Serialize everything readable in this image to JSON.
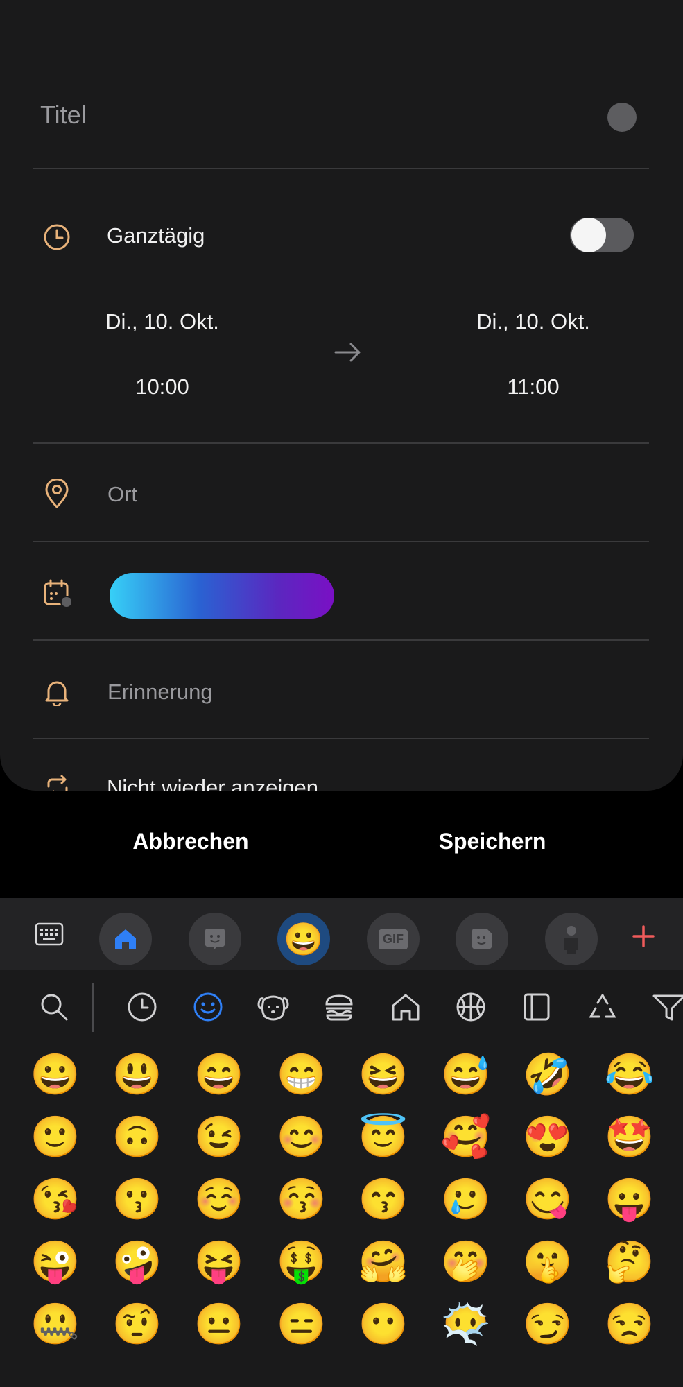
{
  "form": {
    "title_placeholder": "Titel",
    "all_day_label": "Ganztägig",
    "all_day_on": false,
    "start_date": "Di., 10. Okt.",
    "start_time": "10:00",
    "end_date": "Di., 10. Okt.",
    "end_time": "11:00",
    "location_placeholder": "Ort",
    "reminder_placeholder": "Erinnerung",
    "repeat_label": "Nicht wieder anzeigen"
  },
  "actions": {
    "cancel_label": "Abbrechen",
    "save_label": "Speichern"
  },
  "colors": {
    "accent_icon": "#e8b27a",
    "keyboard_accent": "#2f7ff5",
    "add_plus": "#ef5b5b"
  },
  "keyboard": {
    "toolbar": [
      "keyboard-icon",
      "home-icon",
      "sticker-icon",
      "emoji-icon",
      "gif-icon",
      "bitmoji-icon",
      "avatar-icon",
      "plus-icon"
    ],
    "gif_label": "GIF",
    "categories": [
      "search-icon",
      "recent-icon",
      "smileys-icon",
      "animals-icon",
      "food-icon",
      "places-icon",
      "activity-icon",
      "objects-icon",
      "symbols-icon",
      "flags-icon"
    ],
    "active_category": "smileys-icon",
    "emojis": [
      [
        "😀",
        "😃",
        "😄",
        "😁",
        "😆",
        "😅",
        "🤣",
        "😂"
      ],
      [
        "🙂",
        "🙃",
        "😉",
        "😊",
        "😇",
        "🥰",
        "😍",
        "🤩"
      ],
      [
        "😘",
        "😗",
        "☺️",
        "😚",
        "😙",
        "🥲",
        "😋",
        "😛"
      ],
      [
        "😜",
        "🤪",
        "😝",
        "🤑",
        "🤗",
        "🤭",
        "🤫",
        "🤔"
      ],
      [
        "🤐",
        "🤨",
        "😐",
        "😑",
        "😶",
        "😶‍🌫️",
        "😏",
        "😒"
      ]
    ]
  }
}
